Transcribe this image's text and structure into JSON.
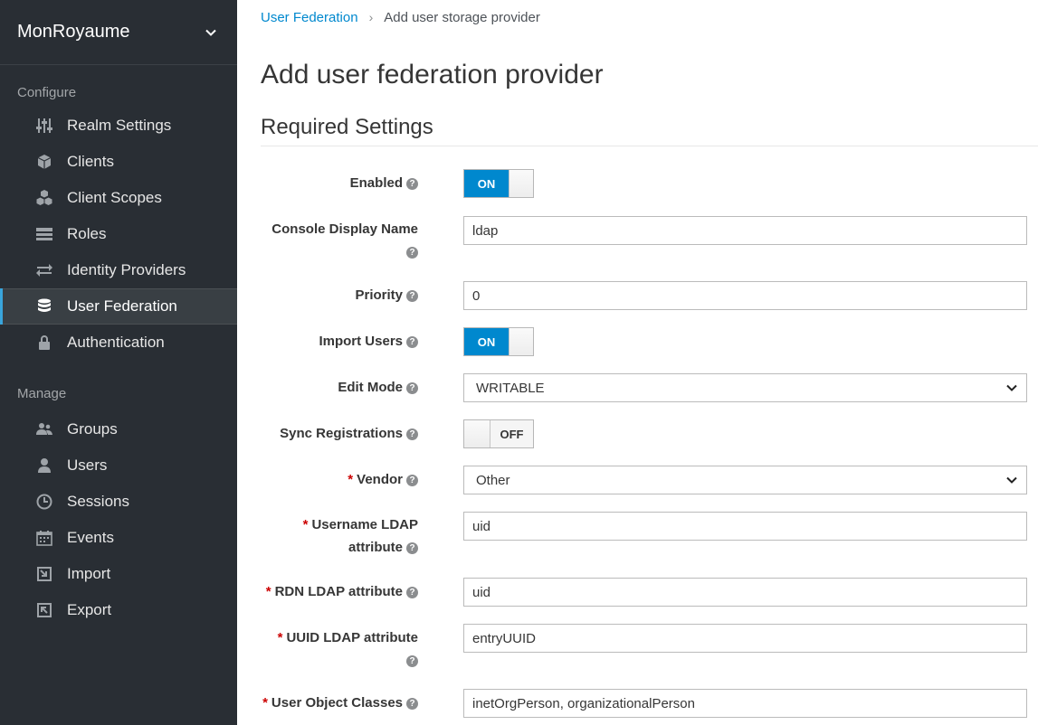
{
  "sidebar": {
    "realm_name": "MonRoyaume",
    "configure_title": "Configure",
    "manage_title": "Manage",
    "configure_items": [
      {
        "label": "Realm Settings",
        "icon": "sliders-icon"
      },
      {
        "label": "Clients",
        "icon": "cube-icon"
      },
      {
        "label": "Client Scopes",
        "icon": "cubes-icon"
      },
      {
        "label": "Roles",
        "icon": "list-icon"
      },
      {
        "label": "Identity Providers",
        "icon": "exchange-icon"
      },
      {
        "label": "User Federation",
        "icon": "database-icon",
        "active": true
      },
      {
        "label": "Authentication",
        "icon": "lock-icon"
      }
    ],
    "manage_items": [
      {
        "label": "Groups",
        "icon": "users-icon"
      },
      {
        "label": "Users",
        "icon": "user-icon"
      },
      {
        "label": "Sessions",
        "icon": "clock-icon"
      },
      {
        "label": "Events",
        "icon": "calendar-icon"
      },
      {
        "label": "Import",
        "icon": "import-icon"
      },
      {
        "label": "Export",
        "icon": "export-icon"
      }
    ]
  },
  "breadcrumb": {
    "parent": "User Federation",
    "separator": "›",
    "current": "Add user storage provider"
  },
  "page_title": "Add user federation provider",
  "section_title": "Required Settings",
  "help_glyph": "?",
  "form": {
    "enabled": {
      "label": "Enabled",
      "value": "ON"
    },
    "console_display_name": {
      "label": "Console Display Name",
      "value": "ldap"
    },
    "priority": {
      "label": "Priority",
      "value": "0"
    },
    "import_users": {
      "label": "Import Users",
      "value": "ON"
    },
    "edit_mode": {
      "label": "Edit Mode",
      "value": "WRITABLE"
    },
    "sync_registrations": {
      "label": "Sync Registrations",
      "value": "OFF"
    },
    "vendor": {
      "label": "Vendor",
      "value": "Other",
      "required": true
    },
    "username_ldap_attribute": {
      "label_line1": "Username LDAP",
      "label_line2": "attribute",
      "value": "uid",
      "required": true
    },
    "rdn_ldap_attribute": {
      "label": "RDN LDAP attribute",
      "value": "uid",
      "required": true
    },
    "uuid_ldap_attribute": {
      "label": "UUID LDAP attribute",
      "value": "entryUUID",
      "required": true
    },
    "user_object_classes": {
      "label": "User Object Classes",
      "value": "inetOrgPerson, organizationalPerson",
      "required": true
    }
  },
  "required_marker": "*",
  "colors": {
    "sidebar_bg": "#292e34",
    "accent": "#0088ce",
    "active_indicator": "#39a5dc",
    "required": "#cc0000"
  }
}
